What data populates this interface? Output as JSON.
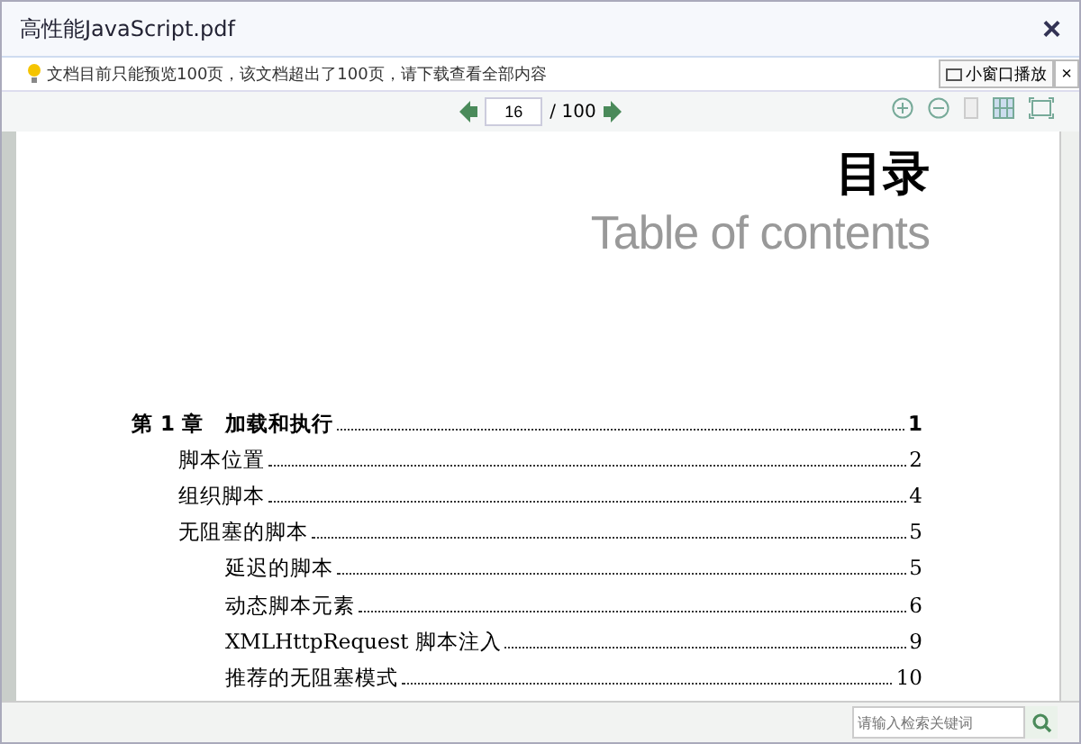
{
  "window": {
    "title": "高性能JavaScript.pdf",
    "close": "×"
  },
  "notice": {
    "text": "文档目前只能预览100页，该文档超出了100页，请下载查看全部内容",
    "mini_button": "小窗口播放",
    "mini_close": "×"
  },
  "toolbar": {
    "page": "16",
    "total": "/ 100"
  },
  "page": {
    "heading": "目录",
    "subheading": "Table of contents",
    "toc": [
      {
        "title": "第 1 章　加载和执行",
        "page": "1",
        "children": [
          {
            "title": "脚本位置",
            "page": "2"
          },
          {
            "title": "组织脚本",
            "page": "4"
          },
          {
            "title": "无阻塞的脚本",
            "page": "5",
            "children": [
              {
                "title": "延迟的脚本",
                "page": "5"
              },
              {
                "title": "动态脚本元素",
                "page": "6"
              },
              {
                "title": "XMLHttpRequest 脚本注入",
                "page": "9"
              },
              {
                "title": "推荐的无阻塞模式",
                "page": "10"
              }
            ]
          }
        ]
      }
    ]
  },
  "search": {
    "placeholder": "请输入检索关键词"
  }
}
